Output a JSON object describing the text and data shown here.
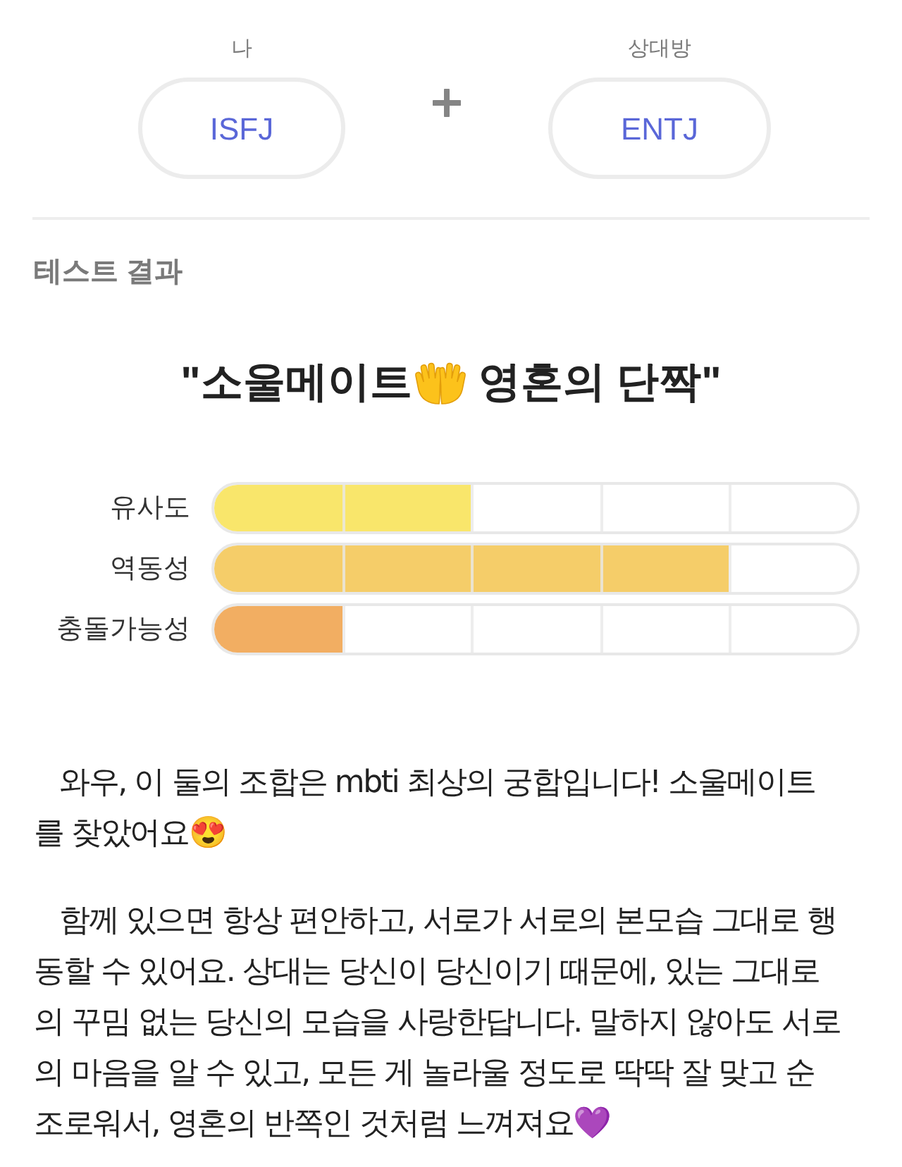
{
  "pair": [
    {
      "label": "나",
      "type": "ISFJ"
    },
    {
      "label": "상대방",
      "type": "ENTJ"
    }
  ],
  "section_title": "테스트 결과",
  "result_title": {
    "start": "\"소울메이트",
    "end": "영혼의 단짝\""
  },
  "meters": [
    {
      "label": "유사도",
      "level": 0.4,
      "color": "#f9e66b"
    },
    {
      "label": "역동성",
      "level": 0.8,
      "color": "#f5cd69"
    },
    {
      "label": "충돌가능성",
      "level": 0.2,
      "color": "#f2ae62"
    }
  ],
  "paragraphs": [
    "와우, 이 둘의 조합은 mbti 최상의 궁합입니다! 소울메이트를 찾았어요😍",
    "함께 있으면 항상 편안하고, 서로가 서로의 본모습 그대로 행동할 수 있어요. 상대는 당신이 당신이기 때문에, 있는 그대로의 꾸밈 없는 당신의 모습을 사랑한답니다. 말하지 않아도 서로의 마음을 알 수 있고, 모든 게 놀라울 정도로 딱딱 잘 맞고 순조로워서, 영혼의 반쪽인 것처럼 느껴져요💜"
  ]
}
